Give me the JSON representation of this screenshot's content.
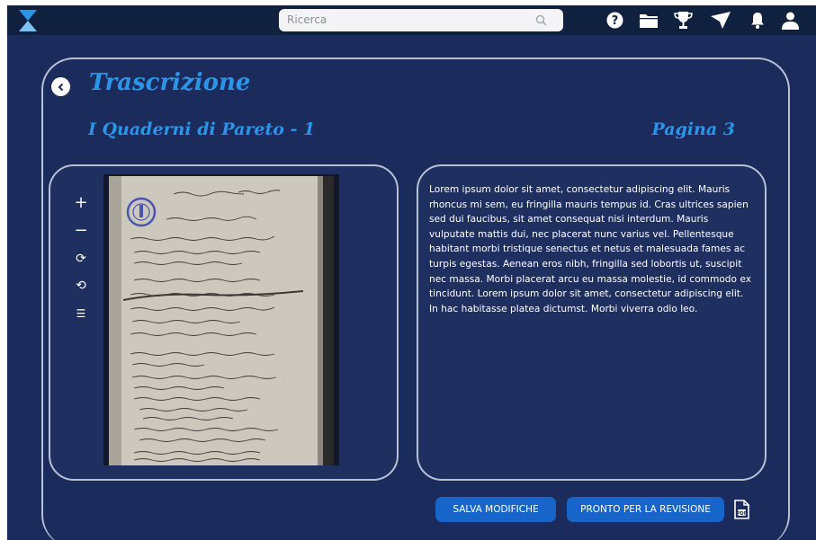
{
  "header": {
    "search_placeholder": "Ricerca",
    "icons": [
      "hourglass-logo-icon",
      "search-icon",
      "help-icon",
      "folder-icon",
      "trophy-icon",
      "send-icon",
      "bell-icon",
      "user-icon"
    ]
  },
  "page": {
    "title": "Trascrizione",
    "subtitle": "I Quaderni di Pareto - 1",
    "page_label": "Pagina 3"
  },
  "viewer_tools": {
    "zoom_in": "+",
    "zoom_out": "−",
    "rotate_cw": "⟳",
    "rotate_ccw": "⟲",
    "adjust": "☰"
  },
  "transcription": {
    "text": "Lorem ipsum dolor sit amet, consectetur adipiscing elit. Mauris rhoncus mi sem, eu fringilla mauris tempus id. Cras ultrices sapien sed dui faucibus, sit amet consequat nisi interdum. Mauris vulputate mattis dui, nec placerat nunc varius vel. Pellentesque habitant morbi tristique senectus et netus et malesuada fames ac turpis egestas. Aenean eros nibh, fringilla sed lobortis ut, suscipit nec massa. Morbi placerat arcu eu massa molestie, id commodo ex tincidunt. Lorem ipsum dolor sit amet, consectetur adipiscing elit. In hac habitasse platea dictumst. Morbi viverra odio leo."
  },
  "actions": {
    "save_label": "SALVA MODIFICHE",
    "review_label": "PRONTO PER LA REVISIONE"
  },
  "colors": {
    "background": "#1a2b5c",
    "topbar": "#10203f",
    "accent": "#2b96e8",
    "button": "#1765c9"
  }
}
